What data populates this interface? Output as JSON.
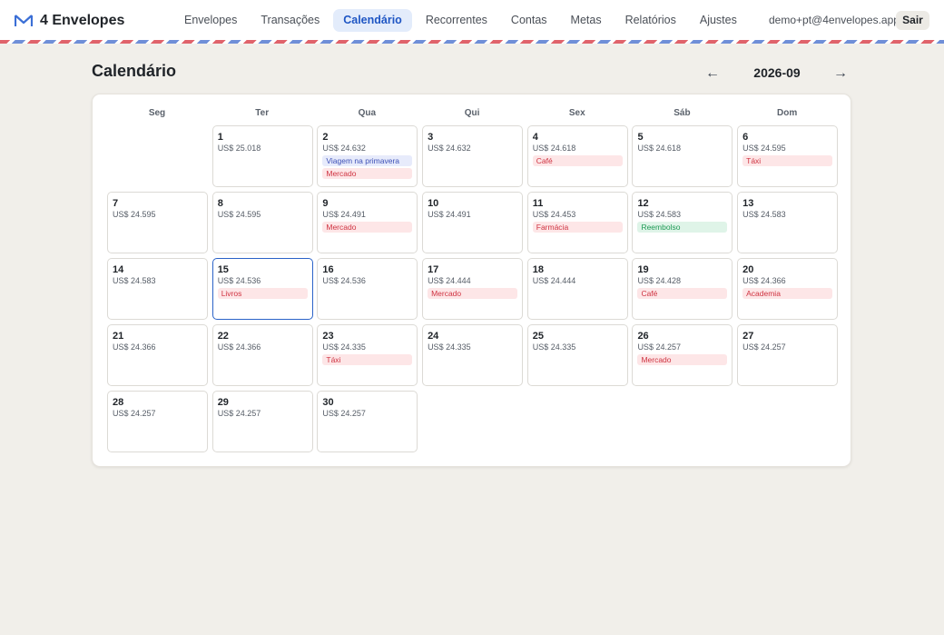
{
  "brand": {
    "name": "4 Envelopes",
    "logo": "envelope-logo-icon"
  },
  "nav": [
    {
      "label": "Envelopes",
      "active": false
    },
    {
      "label": "Transações",
      "active": false
    },
    {
      "label": "Calendário",
      "active": true
    },
    {
      "label": "Recorrentes",
      "active": false
    },
    {
      "label": "Contas",
      "active": false
    },
    {
      "label": "Metas",
      "active": false
    },
    {
      "label": "Relatórios",
      "active": false
    },
    {
      "label": "Ajustes",
      "active": false
    }
  ],
  "user": {
    "email": "demo+pt@4envelopes.app",
    "logout_label": "Sair"
  },
  "page": {
    "title": "Calendário",
    "month": "2026-09",
    "prev_arrow": "←",
    "next_arrow": "→"
  },
  "calendar": {
    "weekdays": [
      "Seg",
      "Ter",
      "Qua",
      "Qui",
      "Sex",
      "Sáb",
      "Dom"
    ],
    "leading_blanks": 1,
    "today": 15,
    "days": [
      {
        "num": "1",
        "balance": "US$ 25.018",
        "tags": []
      },
      {
        "num": "2",
        "balance": "US$ 24.632",
        "tags": [
          {
            "label": "Viagem na primavera",
            "kind": "goal"
          },
          {
            "label": "Mercado",
            "kind": "exp"
          }
        ]
      },
      {
        "num": "3",
        "balance": "US$ 24.632",
        "tags": []
      },
      {
        "num": "4",
        "balance": "US$ 24.618",
        "tags": [
          {
            "label": "Café",
            "kind": "exp"
          }
        ]
      },
      {
        "num": "5",
        "balance": "US$ 24.618",
        "tags": []
      },
      {
        "num": "6",
        "balance": "US$ 24.595",
        "tags": [
          {
            "label": "Táxi",
            "kind": "exp"
          }
        ]
      },
      {
        "num": "7",
        "balance": "US$ 24.595",
        "tags": []
      },
      {
        "num": "8",
        "balance": "US$ 24.595",
        "tags": []
      },
      {
        "num": "9",
        "balance": "US$ 24.491",
        "tags": [
          {
            "label": "Mercado",
            "kind": "exp"
          }
        ]
      },
      {
        "num": "10",
        "balance": "US$ 24.491",
        "tags": []
      },
      {
        "num": "11",
        "balance": "US$ 24.453",
        "tags": [
          {
            "label": "Farmácia",
            "kind": "exp"
          }
        ]
      },
      {
        "num": "12",
        "balance": "US$ 24.583",
        "tags": [
          {
            "label": "Reembolso",
            "kind": "inc"
          }
        ]
      },
      {
        "num": "13",
        "balance": "US$ 24.583",
        "tags": []
      },
      {
        "num": "14",
        "balance": "US$ 24.583",
        "tags": []
      },
      {
        "num": "15",
        "balance": "US$ 24.536",
        "tags": [
          {
            "label": "Livros",
            "kind": "exp"
          }
        ]
      },
      {
        "num": "16",
        "balance": "US$ 24.536",
        "tags": []
      },
      {
        "num": "17",
        "balance": "US$ 24.444",
        "tags": [
          {
            "label": "Mercado",
            "kind": "exp"
          }
        ]
      },
      {
        "num": "18",
        "balance": "US$ 24.444",
        "tags": []
      },
      {
        "num": "19",
        "balance": "US$ 24.428",
        "tags": [
          {
            "label": "Café",
            "kind": "exp"
          }
        ]
      },
      {
        "num": "20",
        "balance": "US$ 24.366",
        "tags": [
          {
            "label": "Academia",
            "kind": "exp"
          }
        ]
      },
      {
        "num": "21",
        "balance": "US$ 24.366",
        "tags": []
      },
      {
        "num": "22",
        "balance": "US$ 24.366",
        "tags": []
      },
      {
        "num": "23",
        "balance": "US$ 24.335",
        "tags": [
          {
            "label": "Táxi",
            "kind": "exp"
          }
        ]
      },
      {
        "num": "24",
        "balance": "US$ 24.335",
        "tags": []
      },
      {
        "num": "25",
        "balance": "US$ 24.335",
        "tags": []
      },
      {
        "num": "26",
        "balance": "US$ 24.257",
        "tags": [
          {
            "label": "Mercado",
            "kind": "exp"
          }
        ]
      },
      {
        "num": "27",
        "balance": "US$ 24.257",
        "tags": []
      },
      {
        "num": "28",
        "balance": "US$ 24.257",
        "tags": []
      },
      {
        "num": "29",
        "balance": "US$ 24.257",
        "tags": []
      },
      {
        "num": "30",
        "balance": "US$ 24.257",
        "tags": []
      }
    ]
  },
  "colors": {
    "accent": "#1f56c4",
    "expense": "#cf3341",
    "income": "#1f9a55",
    "goal": "#3c4fb6"
  }
}
